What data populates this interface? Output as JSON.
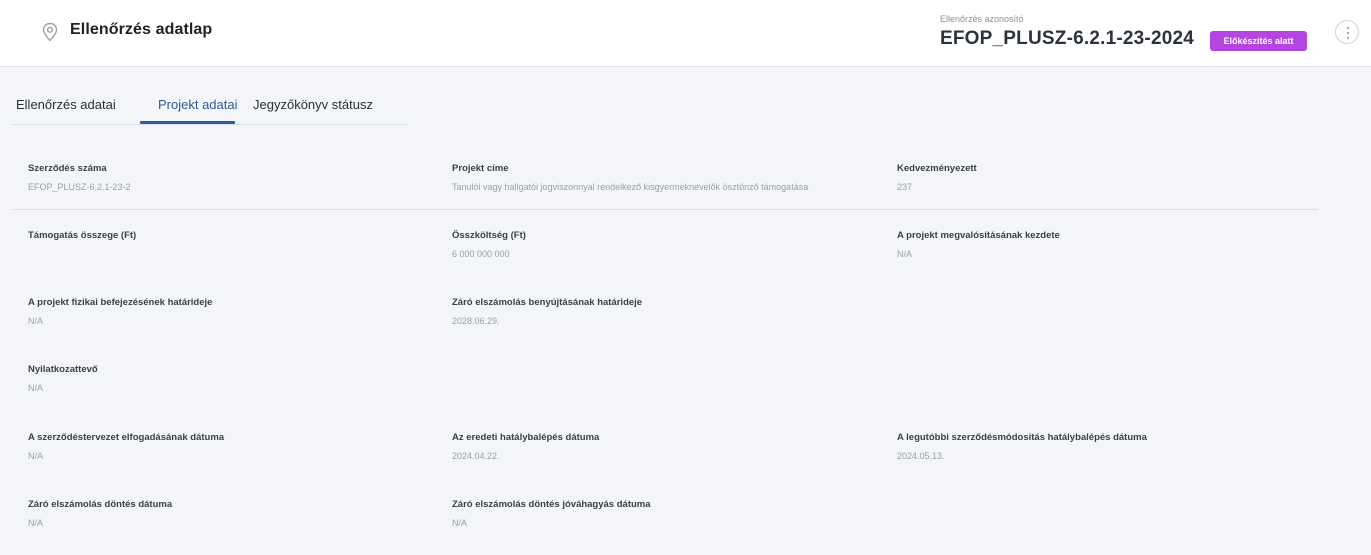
{
  "header": {
    "title": "Ellenőrzés adatlap",
    "id_label": "Ellenőrzés azonosító",
    "id_value": "EFOP_PLUSZ-6.2.1-23-2024",
    "status": "Előkészítés alatt",
    "status_color": "#b545e0",
    "icon": "location-pin-icon",
    "menu_icon": "more-vertical-icon"
  },
  "tabs": [
    {
      "label": "Ellenőrzés adatai",
      "active": false
    },
    {
      "label": "Projekt adatai",
      "active": true
    },
    {
      "label": "Jegyzőkönyv státusz",
      "active": false
    }
  ],
  "accent_color": "#2d5c96",
  "fields": {
    "szerzodes_szama": {
      "label": "Szerződés száma",
      "value": "EFOP_PLUSZ-6.2.1-23-2"
    },
    "projekt_cime": {
      "label": "Projekt címe",
      "value": "Tanulói vagy hallgatói jogviszonnyal rendelkező kisgyermeknevelők ösztönző támogatása"
    },
    "kedvezmenyezett": {
      "label": "Kedvezményezett",
      "value": "237"
    },
    "tamogatas_osszege": {
      "label": "Támogatás összege (Ft)",
      "value": ""
    },
    "osszkoltseg": {
      "label": "Összköltség (Ft)",
      "value": "6 000 000 000"
    },
    "megvalositas_kezdete": {
      "label": "A projekt megvalósításának kezdete",
      "value": "N/A"
    },
    "fizikai_befejezes": {
      "label": "A projekt fizikai befejezésének határideje",
      "value": "N/A"
    },
    "zaro_elszamolas_hatarido": {
      "label": "Záró elszámolás benyújtásának határideje",
      "value": "2028.06.29."
    },
    "nyilatkozattevo": {
      "label": "Nyilatkozattevő",
      "value": "N/A"
    },
    "szerzodestervezet_elfogadas": {
      "label": "A szerződéstervezet elfogadásának dátuma",
      "value": "N/A"
    },
    "eredeti_hatalybalepes": {
      "label": "Az eredeti hatálybalépés dátuma",
      "value": "2024.04.22."
    },
    "legutobbi_modositas": {
      "label": "A legutóbbi szerződésmódosítás hatálybalépés dátuma",
      "value": "2024.05.13."
    },
    "zaro_elszamolas_dontes": {
      "label": "Záró elszámolás döntés dátuma",
      "value": "N/A"
    },
    "zaro_elszamolas_jovahagyas": {
      "label": "Záró elszámolás döntés jóváhagyás dátuma",
      "value": "N/A"
    }
  }
}
